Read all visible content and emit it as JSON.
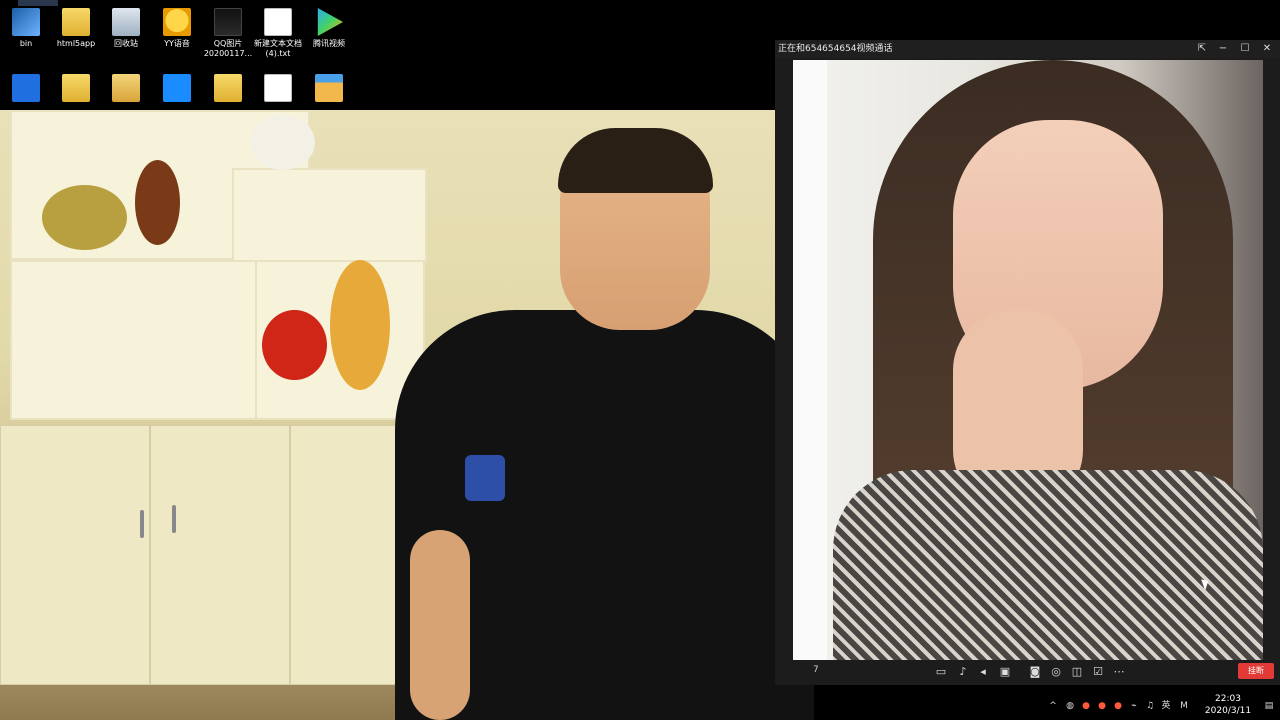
{
  "desktop": {
    "icons_row1": [
      {
        "label": "bin",
        "icon": "person-app-icon"
      },
      {
        "label": "html5app",
        "icon": "folder-icon"
      },
      {
        "label": "回收站",
        "icon": "recycle-bin-icon"
      },
      {
        "label": "YY语音",
        "icon": "yy-voice-icon"
      },
      {
        "label": "QQ图片\n20200117...",
        "icon": "image-file-icon"
      },
      {
        "label": "新建文本文档\n(4).txt",
        "icon": "text-file-icon"
      },
      {
        "label": "腾讯视频",
        "icon": "tencent-video-icon"
      }
    ],
    "icons_row2": [
      {
        "label": "",
        "icon": "wps-icon"
      },
      {
        "label": "",
        "icon": "folder-icon"
      },
      {
        "label": "",
        "icon": "user-folder-icon"
      },
      {
        "label": "",
        "icon": "teamviewer-icon"
      },
      {
        "label": "",
        "icon": "folder-icon"
      },
      {
        "label": "",
        "icon": "text-file-icon"
      },
      {
        "label": "",
        "icon": "archive-icon"
      }
    ]
  },
  "call_window": {
    "title": "正在和654654654视频通话",
    "controls": {
      "counter": "7",
      "hangup_label": "挂断"
    },
    "titlebar_icons": [
      "pin-icon",
      "minimize-icon",
      "maximize-icon",
      "close-icon"
    ],
    "control_icons": [
      "screen-share-icon",
      "microphone-icon",
      "speaker-icon",
      "camera-icon",
      "snapshot-icon",
      "record-icon",
      "layout-icon",
      "whiteboard-icon",
      "more-icon"
    ]
  },
  "taskbar": {
    "tray": {
      "chevron": "^",
      "ime": "英",
      "ime_mode": "M",
      "time": "22:03",
      "date": "2020/3/11"
    }
  },
  "colors": {
    "hangup": "#e23a36",
    "titlebar": "#1f1f1f"
  }
}
